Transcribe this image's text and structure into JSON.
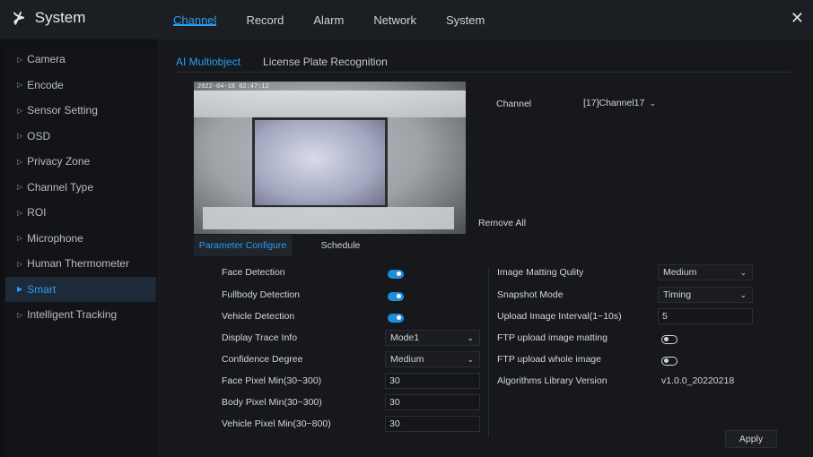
{
  "app": {
    "logo_mark": "⊁",
    "title": "System"
  },
  "top_tabs": [
    {
      "label": "Channel",
      "active": true
    },
    {
      "label": "Record"
    },
    {
      "label": "Alarm"
    },
    {
      "label": "Network"
    },
    {
      "label": "System"
    }
  ],
  "close_glyph": "✕",
  "sidebar": {
    "items": [
      {
        "label": "Camera"
      },
      {
        "label": "Encode"
      },
      {
        "label": "Sensor Setting"
      },
      {
        "label": "OSD"
      },
      {
        "label": "Privacy Zone"
      },
      {
        "label": "Channel Type"
      },
      {
        "label": "ROI"
      },
      {
        "label": "Microphone"
      },
      {
        "label": "Human Thermometer"
      },
      {
        "label": "Smart",
        "active": true
      },
      {
        "label": "Intelligent Tracking"
      }
    ]
  },
  "sub_tabs": [
    {
      "label": "AI Multiobject",
      "active": true
    },
    {
      "label": "License Plate Recognition"
    }
  ],
  "preview": {
    "timestamp": "2022-04-18 02:47:12"
  },
  "channel": {
    "label": "Channel",
    "value": "[17]Channel17"
  },
  "remove_all": "Remove All",
  "param_tabs": [
    {
      "label": "Parameter Configure",
      "active": true
    },
    {
      "label": "Schedule"
    }
  ],
  "left_fields": {
    "face_detection": {
      "label": "Face Detection",
      "on": true
    },
    "fullbody_detection": {
      "label": "Fullbody Detection",
      "on": true
    },
    "vehicle_detection": {
      "label": "Vehicle Detection",
      "on": true
    },
    "display_trace_info": {
      "label": "Display Trace Info",
      "value": "Mode1"
    },
    "confidence_degree": {
      "label": "Confidence Degree",
      "value": "Medium"
    },
    "face_pixel_min": {
      "label": "Face Pixel Min(30~300)",
      "value": "30"
    },
    "body_pixel_min": {
      "label": "Body Pixel Min(30~300)",
      "value": "30"
    },
    "vehicle_pixel_min": {
      "label": "Vehicle Pixel Min(30~800)",
      "value": "30"
    }
  },
  "right_fields": {
    "image_matting_quality": {
      "label": "Image Matting Qulity",
      "value": "Medium"
    },
    "snapshot_mode": {
      "label": "Snapshot Mode",
      "value": "Timing"
    },
    "upload_interval": {
      "label": "Upload Image Interval(1~10s)",
      "value": "5"
    },
    "ftp_image_matting": {
      "label": "FTP upload image matting",
      "on": false
    },
    "ftp_whole_image": {
      "label": "FTP upload whole image",
      "on": false
    },
    "algorithms_version": {
      "label": "Algorithms Library Version",
      "value": "v1.0.0_20220218"
    }
  },
  "apply": "Apply",
  "colors": {
    "accent": "#2a9df4",
    "toggle_on": "#1f8ddc"
  }
}
